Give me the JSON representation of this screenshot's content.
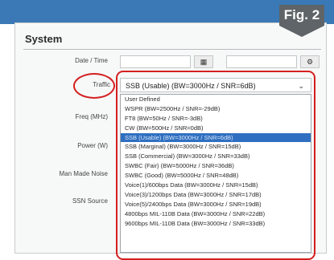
{
  "figure": {
    "badge": "Fig. 2"
  },
  "system": {
    "title": "System",
    "labels": {
      "date_time": "Date / Time",
      "traffic": "Traffic",
      "freq": "Freq (MHz)",
      "power": "Power (W)",
      "noise": "Man Made Noise",
      "ssn": "SSN Source"
    },
    "traffic_selected": "SSB (Usable) (BW=3000Hz / SNR=6dB)",
    "traffic_options": [
      "User Defined",
      "WSPR (BW=2500Hz / SNR=-29dB)",
      "FT8 (BW=50Hz / SNR=-3dB)",
      "CW (BW=500Hz / SNR=0dB)",
      "SSB (Usable) (BW=3000Hz / SNR=6dB)",
      "SSB (Marginal) (BW=3000Hz / SNR=15dB)",
      "SSB (Commercial) (BW=3000Hz / SNR=33dB)",
      "SWBC (Fair) (BW=5000Hz / SNR=36dB)",
      "SWBC (Good) (BW=5000Hz / SNR=48dB)",
      "Voice(1)/600bps Data (BW=3000Hz / SNR=15dB)",
      "Voice(3)/1200bps Data (BW=3000Hz / SNR=17dB)",
      "Voice(5)/2400bps Data (BW=3000Hz / SNR=19dB)",
      "4800bps MIL-110B Data (BW=3000Hz / SNR=22dB)",
      "9600bps MIL-110B Data (BW=3000Hz / SNR=33dB)"
    ],
    "selected_index": 4,
    "icons": {
      "calendar": "calendar-icon",
      "clock": "clock-icon",
      "chevron": "chevron-down-icon"
    }
  }
}
